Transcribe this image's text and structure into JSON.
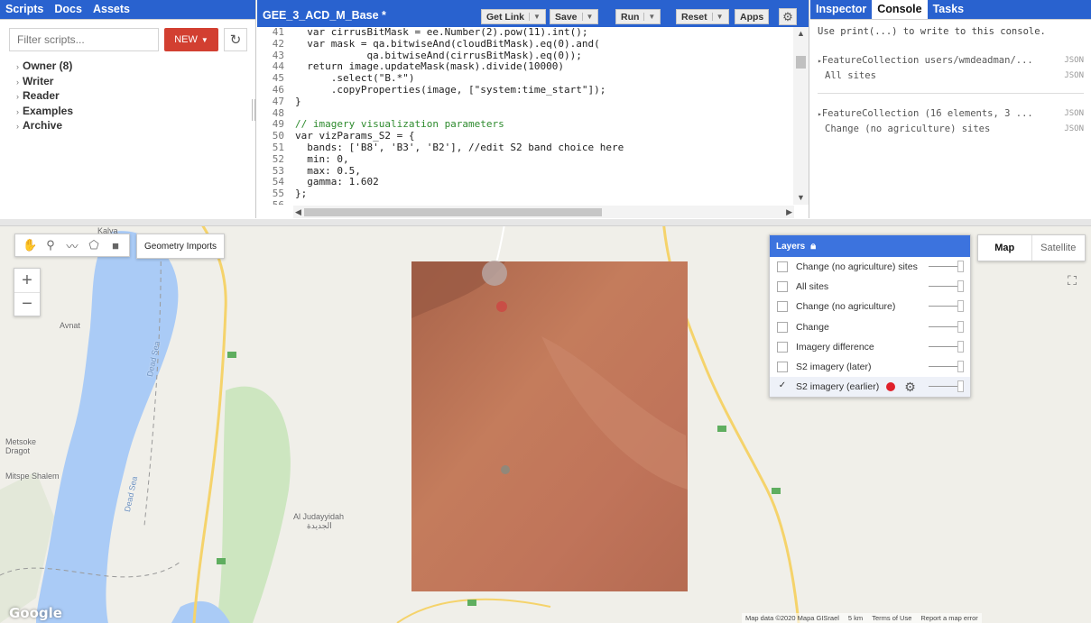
{
  "left_panel": {
    "tabs": [
      "Scripts",
      "Docs",
      "Assets"
    ],
    "filter_placeholder": "Filter scripts...",
    "new_button": "NEW",
    "tree": [
      "Owner (8)",
      "Writer",
      "Reader",
      "Examples",
      "Archive"
    ]
  },
  "editor": {
    "file_name": "GEE_3_ACD_M_Base *",
    "buttons": {
      "get_link": "Get Link",
      "save": "Save",
      "run": "Run",
      "reset": "Reset",
      "apps": "Apps"
    },
    "lines": [
      {
        "n": "41",
        "t": "  var cirrusBitMask = ee.Number(2).pow(11).int();"
      },
      {
        "n": "42",
        "t": "  var mask = qa.bitwiseAnd(cloudBitMask).eq(0).and("
      },
      {
        "n": "43",
        "t": "            qa.bitwiseAnd(cirrusBitMask).eq(0));"
      },
      {
        "n": "44",
        "t": "  return image.updateMask(mask).divide(10000)"
      },
      {
        "n": "45",
        "t": "      .select(\"B.*\")"
      },
      {
        "n": "46",
        "t": "      .copyProperties(image, [\"system:time_start\"]);"
      },
      {
        "n": "47",
        "t": "}"
      },
      {
        "n": "48",
        "t": ""
      },
      {
        "n": "49",
        "t": "// imagery visualization parameters"
      },
      {
        "n": "50",
        "t": "var vizParams_S2 = {"
      },
      {
        "n": "51",
        "t": "  bands: ['B8', 'B3', 'B2'], //edit S2 band choice here"
      },
      {
        "n": "52",
        "t": "  min: 0,"
      },
      {
        "n": "53",
        "t": "  max: 0.5,"
      },
      {
        "n": "54",
        "t": "  gamma: 1.602"
      },
      {
        "n": "55",
        "t": "};"
      },
      {
        "n": "56",
        "t": ""
      }
    ]
  },
  "right_panel": {
    "tabs": [
      "Inspector",
      "Console",
      "Tasks"
    ],
    "hint": "Use print(...) to write to this console.",
    "entries": [
      {
        "title": "FeatureCollection users/wmdeadman/...",
        "badge1": "JSON",
        "sub": "All sites",
        "badge2": "JSON"
      },
      {
        "title": "FeatureCollection (16 elements, 3 ...",
        "badge1": "JSON",
        "sub": "Change (no agriculture) sites",
        "badge2": "JSON"
      }
    ]
  },
  "map": {
    "geometry_imports": "Geometry Imports",
    "layers_title": "Layers",
    "layers": [
      {
        "label": "Change (no agriculture) sites",
        "checked": false
      },
      {
        "label": "All sites",
        "checked": false
      },
      {
        "label": "Change (no agriculture)",
        "checked": false
      },
      {
        "label": "Change",
        "checked": false
      },
      {
        "label": "Imagery difference",
        "checked": false
      },
      {
        "label": "S2 imagery (later)",
        "checked": false
      },
      {
        "label": "S2 imagery (earlier)",
        "checked": true
      }
    ],
    "map_types": [
      "Map",
      "Satellite"
    ],
    "places": [
      "Kalya",
      "Avnat",
      "Metsoke Dragot",
      "Mitspe Shalem",
      "Al Judayyidah",
      "الجديدة",
      "Dead Sea",
      "Dead Sea"
    ],
    "google": "Google",
    "attribution": [
      "Map data ©2020 Mapa GISrael",
      "5 km",
      "Terms of Use",
      "Report a map error"
    ],
    "colors": {
      "water": "#aacbf6",
      "land": "#f0efe9",
      "green": "#cde6c0",
      "imagery": "#c0714f"
    }
  }
}
